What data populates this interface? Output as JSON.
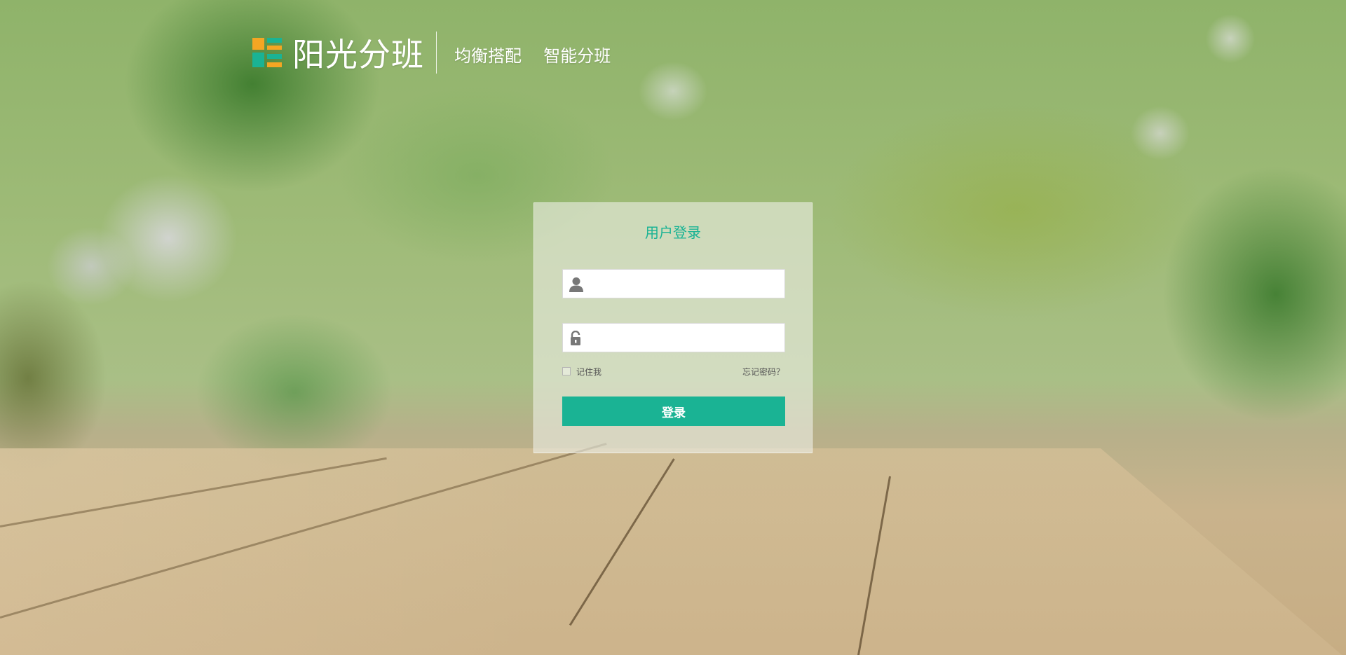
{
  "header": {
    "brand": "阳光分班",
    "slogan": "均衡搭配  智能分班"
  },
  "login": {
    "title": "用户登录",
    "username_value": "",
    "password_value": "",
    "remember_label": "记住我",
    "remember_checked": false,
    "forgot_label": "忘记密码？",
    "submit_label": "登录"
  },
  "icons": {
    "username": "user-icon",
    "password": "unlock-icon"
  },
  "colors": {
    "accent": "#1ab394",
    "logo_orange": "#f5a623",
    "logo_teal": "#1ab394"
  }
}
